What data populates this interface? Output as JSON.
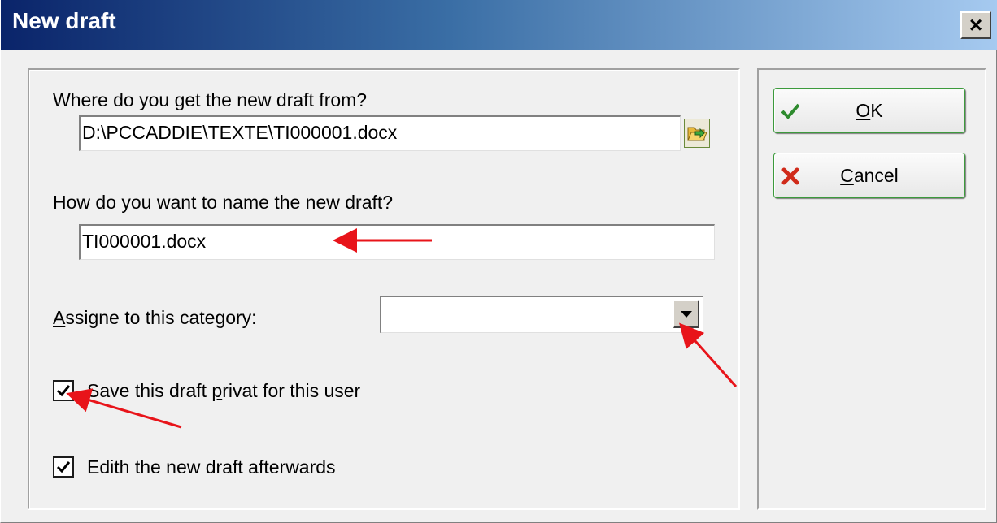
{
  "window": {
    "title": "New draft",
    "close_label": "×"
  },
  "form": {
    "source_label": "Where do you get the new draft from?",
    "source_value": "D:\\PCCADDIE\\TEXTE\\TI000001.docx",
    "name_label": "How do you want to name the new draft?",
    "name_value": "TI000001.docx",
    "category_label_first": "A",
    "category_label_rest": "ssigne to this category:",
    "category_value": "",
    "private_label_pre": "Save this draft ",
    "private_label_mnemonic": "p",
    "private_label_post": "rivat for this user",
    "private_checked": true,
    "edit_label": "Edith the new draft afterwards",
    "edit_checked": true
  },
  "buttons": {
    "ok_mnemonic": "O",
    "ok_rest": "K",
    "cancel_mnemonic": "C",
    "cancel_rest": "ancel"
  },
  "colors": {
    "annotation_arrow": "#e8141a",
    "ok_icon": "#2e8b2e",
    "cancel_icon": "#d02a1a"
  },
  "icons": {
    "ok": "checkmark-icon",
    "cancel": "x-icon",
    "folder": "open-folder-icon",
    "dropdown": "triangle-down-icon"
  }
}
